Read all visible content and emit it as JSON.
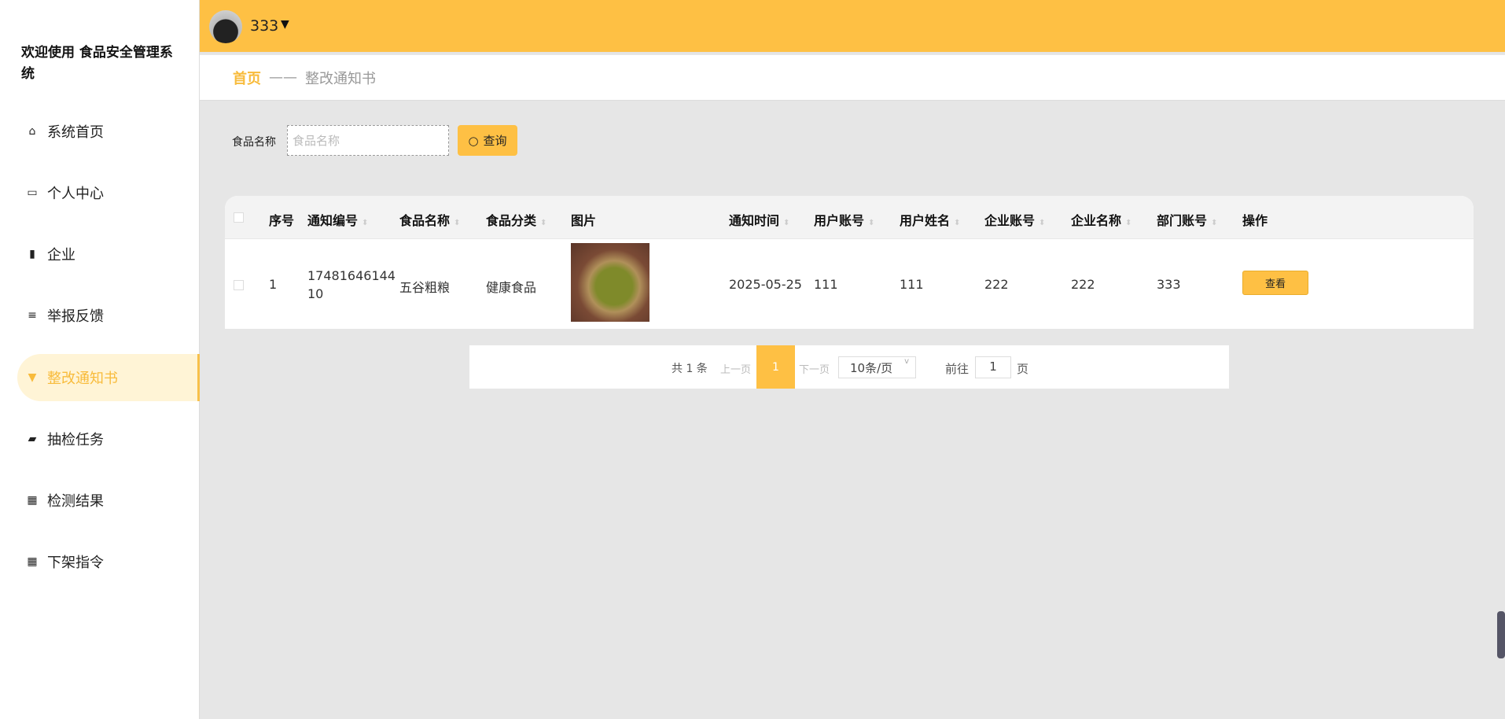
{
  "sidebar": {
    "title": "欢迎使用 食品安全管理系统",
    "items": [
      {
        "label": "系统首页",
        "icon": "home-icon"
      },
      {
        "label": "个人中心",
        "icon": "card-icon"
      },
      {
        "label": "企业",
        "icon": "bar-chart-icon"
      },
      {
        "label": "举报反馈",
        "icon": "list-icon"
      },
      {
        "label": "整改通知书",
        "icon": "notice-icon",
        "active": true
      },
      {
        "label": "抽检任务",
        "icon": "wallet-icon"
      },
      {
        "label": "检测结果",
        "icon": "grid-icon"
      },
      {
        "label": "下架指令",
        "icon": "grid-icon"
      }
    ]
  },
  "header": {
    "username": "333"
  },
  "breadcrumb": {
    "home": "首页",
    "sep": "——",
    "current": "整改通知书"
  },
  "search": {
    "label": "食品名称",
    "placeholder": "食品名称",
    "value": "",
    "button": "查询"
  },
  "table": {
    "columns": [
      "序号",
      "通知编号",
      "食品名称",
      "食品分类",
      "图片",
      "通知时间",
      "用户账号",
      "用户姓名",
      "企业账号",
      "企业名称",
      "部门账号",
      "操作"
    ],
    "rows": [
      {
        "index": "1",
        "code_line1": "17481646144",
        "code_line2": "10",
        "food": "五谷粗粮",
        "category": "健康食品",
        "time": "2025-05-25",
        "user_account": "111",
        "user_name": "111",
        "ent_account": "222",
        "ent_name": "222",
        "dept_account": "333",
        "action": "查看"
      }
    ]
  },
  "pagination": {
    "total": "共 1 条",
    "prev": "上一页",
    "current": "1",
    "next": "下一页",
    "page_size": "10条/页",
    "goto": "前往",
    "goto_value": "1",
    "page_unit": "页"
  },
  "colors": {
    "accent": "#fec044",
    "active_text": "#f8bb3b",
    "background": "#e6e6e6"
  }
}
